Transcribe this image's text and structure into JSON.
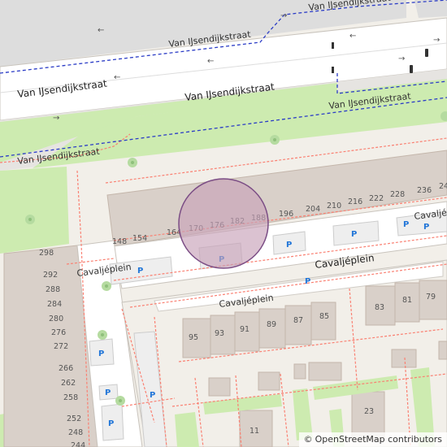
{
  "map": {
    "streets": {
      "main": "Van IJsendijkstraat",
      "square": "Cavaljéplein",
      "square_short": "Cavaljéplein"
    },
    "house_numbers_north": [
      "148",
      "154",
      "164",
      "170",
      "176",
      "182",
      "188",
      "196",
      "204",
      "210",
      "216",
      "222",
      "228",
      "236",
      "24"
    ],
    "house_numbers_west": [
      "298",
      "292",
      "288",
      "284",
      "280",
      "276",
      "272",
      "266",
      "262",
      "258",
      "252",
      "248",
      "244"
    ],
    "house_numbers_south": [
      "95",
      "93",
      "91",
      "89",
      "87",
      "85",
      "83",
      "81",
      "79",
      "23",
      "11"
    ],
    "parking_label": "P",
    "attribution": {
      "symbol": "©",
      "text": "OpenStreetMap contributors"
    },
    "colors": {
      "highlight_fill": "#c7a2b8",
      "highlight_stroke": "#7b4d85",
      "building": "#d9d0c9",
      "park": "#cdebb0",
      "road": "#ffffff"
    }
  }
}
